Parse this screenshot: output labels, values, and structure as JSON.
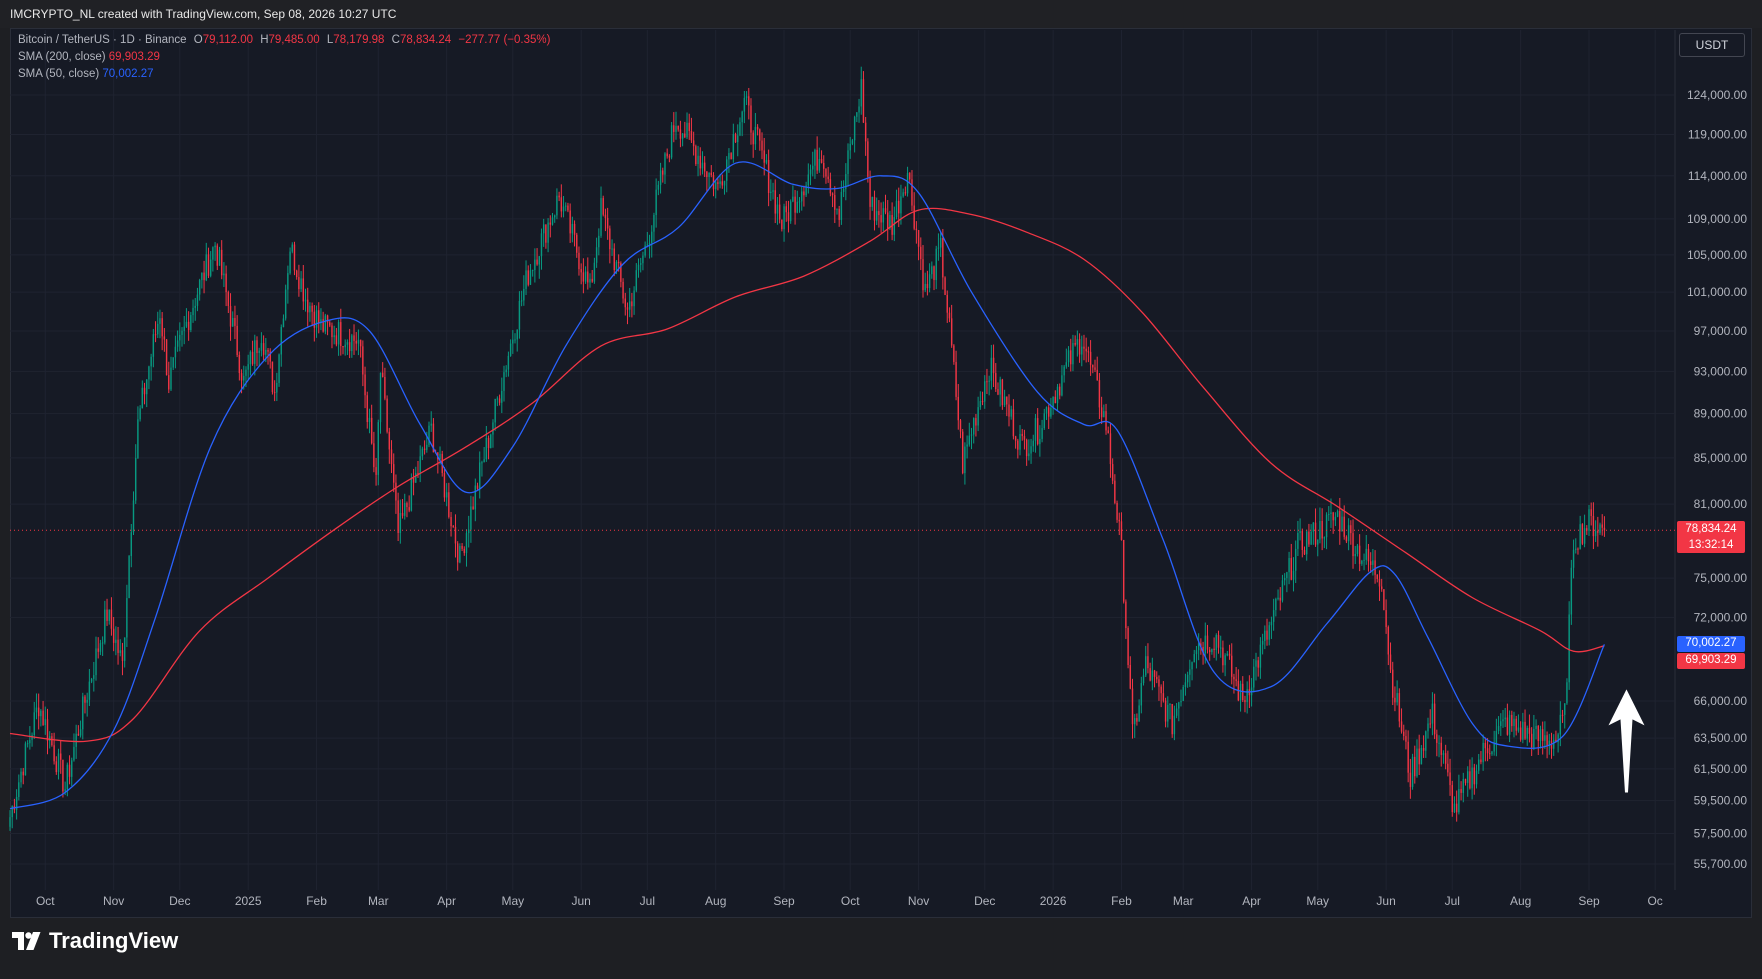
{
  "header": {
    "title": "IMCRYPTO_NL created with TradingView.com, Sep 08, 2026 10:27 UTC"
  },
  "legend": {
    "symbol": "Bitcoin / TetherUS · 1D · Binance",
    "o_label": "O",
    "o_value": "79,112.00",
    "h_label": "H",
    "h_value": "79,485.00",
    "l_label": "L",
    "l_value": "78,179.98",
    "c_label": "C",
    "c_value": "78,834.24",
    "change": "−277.77 (−0.35%)",
    "sma200_name": "SMA (200, close)",
    "sma200_value": "69,903.29",
    "sma50_name": "SMA (50, close)",
    "sma50_value": "70,002.27"
  },
  "currency": "USDT",
  "price_labels": {
    "last_price": "78,834.24",
    "countdown": "13:32:14",
    "sma50": "70,002.27",
    "sma200": "69,903.29"
  },
  "footer": {
    "brand": "TradingView"
  },
  "colors": {
    "up": "#089981",
    "down": "#f23645",
    "sma50": "#2962ff",
    "sma200": "#f23645",
    "background": "#161a25",
    "arrow": "#ffffff"
  },
  "annotation": {
    "type": "arrow",
    "direction": "up",
    "color": "#ffffff",
    "x": "2026-09-18",
    "y_from": 60000,
    "y_to": 66800
  },
  "chart_data": {
    "type": "candlestick",
    "title": "Bitcoin / TetherUS · 1D · Binance",
    "timeframe": "1D",
    "x_range": [
      "2024-09-15",
      "2026-10-10"
    ],
    "x_ticks": [
      {
        "label": "Oct",
        "date": "2024-10-01"
      },
      {
        "label": "Nov",
        "date": "2024-11-01"
      },
      {
        "label": "Dec",
        "date": "2024-12-01"
      },
      {
        "label": "2025",
        "date": "2025-01-01"
      },
      {
        "label": "Feb",
        "date": "2025-02-01"
      },
      {
        "label": "Mar",
        "date": "2025-03-01"
      },
      {
        "label": "Apr",
        "date": "2025-04-01"
      },
      {
        "label": "May",
        "date": "2025-05-01"
      },
      {
        "label": "Jun",
        "date": "2025-06-01"
      },
      {
        "label": "Jul",
        "date": "2025-07-01"
      },
      {
        "label": "Aug",
        "date": "2025-08-01"
      },
      {
        "label": "Sep",
        "date": "2025-09-01"
      },
      {
        "label": "Oct",
        "date": "2025-10-01"
      },
      {
        "label": "Nov",
        "date": "2025-11-01"
      },
      {
        "label": "Dec",
        "date": "2025-12-01"
      },
      {
        "label": "2026",
        "date": "2026-01-01"
      },
      {
        "label": "Feb",
        "date": "2026-02-01"
      },
      {
        "label": "Mar",
        "date": "2026-03-01"
      },
      {
        "label": "Apr",
        "date": "2026-04-01"
      },
      {
        "label": "May",
        "date": "2026-05-01"
      },
      {
        "label": "Jun",
        "date": "2026-06-01"
      },
      {
        "label": "Jul",
        "date": "2026-07-01"
      },
      {
        "label": "Aug",
        "date": "2026-08-01"
      },
      {
        "label": "Sep",
        "date": "2026-09-01"
      },
      {
        "label": "Oc",
        "date": "2026-10-01"
      }
    ],
    "y_scale": "log",
    "y_ticks": [
      {
        "label": "124,000.00",
        "value": 124000
      },
      {
        "label": "119,000.00",
        "value": 119000
      },
      {
        "label": "114,000.00",
        "value": 114000
      },
      {
        "label": "109,000.00",
        "value": 109000
      },
      {
        "label": "105,000.00",
        "value": 105000
      },
      {
        "label": "101,000.00",
        "value": 101000
      },
      {
        "label": "97,000.00",
        "value": 97000
      },
      {
        "label": "93,000.00",
        "value": 93000
      },
      {
        "label": "89,000.00",
        "value": 89000
      },
      {
        "label": "85,000.00",
        "value": 85000
      },
      {
        "label": "81,000.00",
        "value": 81000
      },
      {
        "label": "75,000.00",
        "value": 75000
      },
      {
        "label": "72,000.00",
        "value": 72000
      },
      {
        "label": "66,000.00",
        "value": 66000
      },
      {
        "label": "63,500.00",
        "value": 63500
      },
      {
        "label": "61,500.00",
        "value": 61500
      },
      {
        "label": "59,500.00",
        "value": 59500
      },
      {
        "label": "57,500.00",
        "value": 57500
      },
      {
        "label": "55,700.00",
        "value": 55700
      }
    ],
    "last_price": 78834.24,
    "price_anchors": [
      [
        "2024-09-15",
        58500
      ],
      [
        "2024-09-28",
        65800
      ],
      [
        "2024-10-10",
        60300
      ],
      [
        "2024-10-29",
        72300
      ],
      [
        "2024-11-05",
        68500
      ],
      [
        "2024-11-12",
        88000
      ],
      [
        "2024-11-22",
        99000
      ],
      [
        "2024-11-26",
        91900
      ],
      [
        "2024-12-05",
        98500
      ],
      [
        "2024-12-17",
        106200
      ],
      [
        "2024-12-30",
        92000
      ],
      [
        "2025-01-07",
        97000
      ],
      [
        "2025-01-13",
        91000
      ],
      [
        "2025-01-20",
        106000
      ],
      [
        "2025-01-27",
        100500
      ],
      [
        "2025-02-03",
        97500
      ],
      [
        "2025-02-20",
        96000
      ],
      [
        "2025-02-28",
        82500
      ],
      [
        "2025-03-02",
        93000
      ],
      [
        "2025-03-10",
        78500
      ],
      [
        "2025-03-25",
        87500
      ],
      [
        "2025-04-07",
        76500
      ],
      [
        "2025-04-21",
        87500
      ],
      [
        "2025-05-08",
        103000
      ],
      [
        "2025-05-22",
        111500
      ],
      [
        "2025-06-05",
        101000
      ],
      [
        "2025-06-10",
        110000
      ],
      [
        "2025-06-22",
        99000
      ],
      [
        "2025-07-01",
        106500
      ],
      [
        "2025-07-14",
        121000
      ],
      [
        "2025-08-02",
        112500
      ],
      [
        "2025-08-14",
        123000
      ],
      [
        "2025-08-31",
        108500
      ],
      [
        "2025-09-18",
        117000
      ],
      [
        "2025-09-26",
        109500
      ],
      [
        "2025-10-06",
        125000
      ],
      [
        "2025-10-10",
        110500
      ],
      [
        "2025-10-20",
        108500
      ],
      [
        "2025-10-27",
        114500
      ],
      [
        "2025-11-04",
        101000
      ],
      [
        "2025-11-11",
        105500
      ],
      [
        "2025-11-21",
        84500
      ],
      [
        "2025-12-03",
        93500
      ],
      [
        "2025-12-18",
        86000
      ],
      [
        "2025-12-25",
        87500
      ],
      [
        "2026-01-14",
        96500
      ],
      [
        "2026-01-25",
        88000
      ],
      [
        "2026-02-01",
        77000
      ],
      [
        "2026-02-06",
        63500
      ],
      [
        "2026-02-12",
        68500
      ],
      [
        "2026-02-24",
        64500
      ],
      [
        "2026-03-06",
        70000
      ],
      [
        "2026-03-16",
        70500
      ],
      [
        "2026-03-28",
        66000
      ],
      [
        "2026-04-10",
        71500
      ],
      [
        "2026-04-22",
        77500
      ],
      [
        "2026-05-10",
        80000
      ],
      [
        "2026-05-20",
        77000
      ],
      [
        "2026-05-30",
        75000
      ],
      [
        "2026-06-03",
        68000
      ],
      [
        "2026-06-12",
        61000
      ],
      [
        "2026-06-22",
        65000
      ],
      [
        "2026-07-02",
        58900
      ],
      [
        "2026-07-15",
        62500
      ],
      [
        "2026-07-25",
        64500
      ],
      [
        "2026-08-08",
        63500
      ],
      [
        "2026-08-17",
        63400
      ],
      [
        "2026-08-21",
        65000
      ],
      [
        "2026-08-25",
        78000
      ],
      [
        "2026-09-01",
        79500
      ],
      [
        "2026-09-08",
        78834
      ]
    ],
    "series": [
      {
        "name": "SMA (50, close)",
        "color": "#2962ff",
        "last_value": 70002.27,
        "points": [
          [
            "2024-09-15",
            59000
          ],
          [
            "2024-10-10",
            60000
          ],
          [
            "2024-11-01",
            64000
          ],
          [
            "2024-11-20",
            72000
          ],
          [
            "2024-12-15",
            86000
          ],
          [
            "2025-01-10",
            94500
          ],
          [
            "2025-02-05",
            98000
          ],
          [
            "2025-02-25",
            97000
          ],
          [
            "2025-03-20",
            88000
          ],
          [
            "2025-04-10",
            82000
          ],
          [
            "2025-05-01",
            86000
          ],
          [
            "2025-05-25",
            95500
          ],
          [
            "2025-06-20",
            104000
          ],
          [
            "2025-07-15",
            108000
          ],
          [
            "2025-08-10",
            115500
          ],
          [
            "2025-09-05",
            113000
          ],
          [
            "2025-09-25",
            112500
          ],
          [
            "2025-10-15",
            114000
          ],
          [
            "2025-11-01",
            112000
          ],
          [
            "2025-11-25",
            101000
          ],
          [
            "2025-12-25",
            91000
          ],
          [
            "2026-01-15",
            88000
          ],
          [
            "2026-01-30",
            87500
          ],
          [
            "2026-02-20",
            78000
          ],
          [
            "2026-03-15",
            68000
          ],
          [
            "2026-04-10",
            67000
          ],
          [
            "2026-05-05",
            71500
          ],
          [
            "2026-05-25",
            75500
          ],
          [
            "2026-06-05",
            75300
          ],
          [
            "2026-06-20",
            70500
          ],
          [
            "2026-07-10",
            64500
          ],
          [
            "2026-07-25",
            63000
          ],
          [
            "2026-08-20",
            63600
          ],
          [
            "2026-09-08",
            70002
          ]
        ]
      },
      {
        "name": "SMA (200, close)",
        "color": "#f23645",
        "last_value": 69903.29,
        "points": [
          [
            "2024-09-15",
            63800
          ],
          [
            "2024-10-20",
            63300
          ],
          [
            "2024-11-10",
            64800
          ],
          [
            "2024-12-10",
            71000
          ],
          [
            "2025-01-10",
            75000
          ],
          [
            "2025-02-10",
            79000
          ],
          [
            "2025-03-10",
            82500
          ],
          [
            "2025-04-10",
            86000
          ],
          [
            "2025-05-10",
            90000
          ],
          [
            "2025-06-10",
            95500
          ],
          [
            "2025-07-10",
            97200
          ],
          [
            "2025-08-10",
            100500
          ],
          [
            "2025-09-10",
            102700
          ],
          [
            "2025-10-10",
            106500
          ],
          [
            "2025-11-01",
            110000
          ],
          [
            "2025-11-25",
            109500
          ],
          [
            "2025-12-20",
            107500
          ],
          [
            "2026-01-15",
            104500
          ],
          [
            "2026-02-10",
            99000
          ],
          [
            "2026-03-10",
            91500
          ],
          [
            "2026-04-10",
            84500
          ],
          [
            "2026-05-10",
            80800
          ],
          [
            "2026-06-10",
            77000
          ],
          [
            "2026-07-10",
            73500
          ],
          [
            "2026-08-10",
            71000
          ],
          [
            "2026-08-25",
            69500
          ],
          [
            "2026-09-08",
            69903
          ]
        ]
      }
    ]
  }
}
